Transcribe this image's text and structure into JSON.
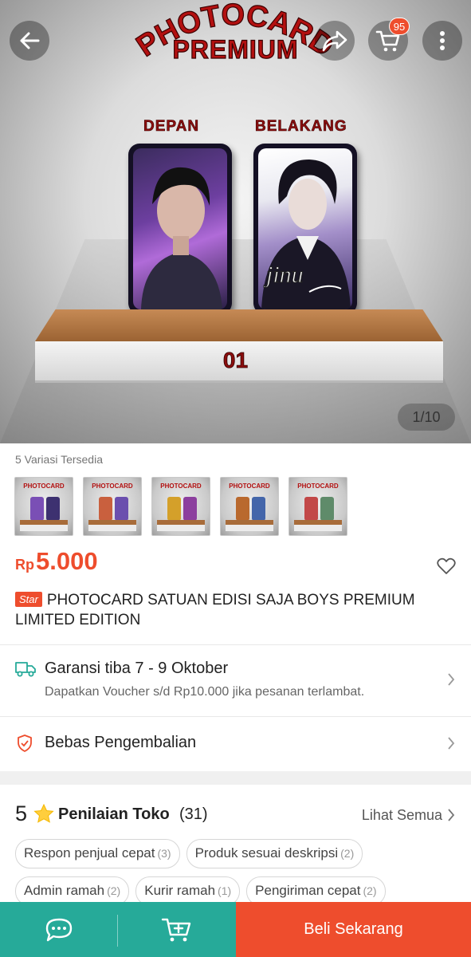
{
  "hero": {
    "title_arc": "PHOTOCARD",
    "title_sub": "PREMIUM",
    "label_front": "DEPAN",
    "label_back": "BELAKANG",
    "signature": "jinu",
    "pedestal_number": "01",
    "image_counter": "1/10",
    "cart_badge": "95"
  },
  "variants": {
    "label": "5 Variasi Tersedia",
    "thumbs": [
      {
        "title": "PHOTOCARD",
        "front": "#7a4fb5",
        "back": "#3d3170"
      },
      {
        "title": "PHOTOCARD",
        "front": "#c9603e",
        "back": "#6b4fae"
      },
      {
        "title": "PHOTOCARD",
        "front": "#d4a02a",
        "back": "#8c3f9e"
      },
      {
        "title": "PHOTOCARD",
        "front": "#b9692e",
        "back": "#4466aa"
      },
      {
        "title": "PHOTOCARD",
        "front": "#c24848",
        "back": "#5f8b6a"
      }
    ]
  },
  "product": {
    "currency": "Rp",
    "price": "5.000",
    "badge": "Star",
    "title": "PHOTOCARD SATUAN EDISI SAJA BOYS PREMIUM LIMITED EDITION"
  },
  "shipping": {
    "title": "Garansi tiba 7 - 9 Oktober",
    "subtitle": "Dapatkan Voucher s/d Rp10.000 jika pesanan terlambat."
  },
  "returns": {
    "title": "Bebas Pengembalian"
  },
  "rating": {
    "score": "5",
    "label": "Penilaian Toko",
    "count": "(31)",
    "see_all": "Lihat Semua",
    "chips": [
      {
        "label": "Respon penjual cepat",
        "count": "(3)"
      },
      {
        "label": "Produk sesuai deskripsi",
        "count": "(2)"
      },
      {
        "label": "Admin ramah",
        "count": "(2)"
      },
      {
        "label": "Kurir ramah",
        "count": "(1)"
      },
      {
        "label": "Pengiriman cepat",
        "count": "(2)"
      }
    ]
  },
  "bottom_bar": {
    "buy_label": "Beli Sekarang"
  },
  "colors": {
    "accent": "#ee4d2d",
    "teal": "#26aa99"
  }
}
